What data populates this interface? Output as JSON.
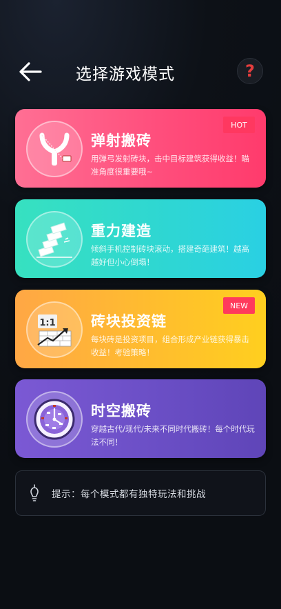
{
  "header": {
    "title": "选择游戏模式",
    "back_icon": "arrow-left-icon",
    "help_label": "?",
    "help_color": "#e43d3d"
  },
  "modes": [
    {
      "title": "弹射搬砖",
      "desc": "用弹弓发射砖块，击中目标建筑获得收益！瞄准角度很重要哦~",
      "badge": "HOT",
      "icon": "slingshot-icon",
      "colors": [
        "#ff6f94",
        "#ff3b6c"
      ]
    },
    {
      "title": "重力建造",
      "desc": "倾斜手机控制砖块滚动，搭建奇葩建筑！越高越好但小心倒塌！",
      "badge": "",
      "icon": "stacked-bricks-icon",
      "colors": [
        "#37e1c0",
        "#2ad0e3"
      ]
    },
    {
      "title": "砖块投资链",
      "desc": "每块砖是投资项目，组合形成产业链获得暴击收益！考验策略！",
      "badge": "NEW",
      "icon": "investment-chart-icon",
      "colors": [
        "#ffa745",
        "#ffcf1f"
      ]
    },
    {
      "title": "时空搬砖",
      "desc": "穿越古代/现代/未来不同时代搬砖！每个时代玩法不同！",
      "badge": "",
      "icon": "time-clock-icon",
      "colors": [
        "#7b59d4",
        "#5f45b8"
      ]
    }
  ],
  "tip": {
    "text": "提示：每个模式都有独特玩法和挑战",
    "icon": "lightbulb-icon"
  }
}
